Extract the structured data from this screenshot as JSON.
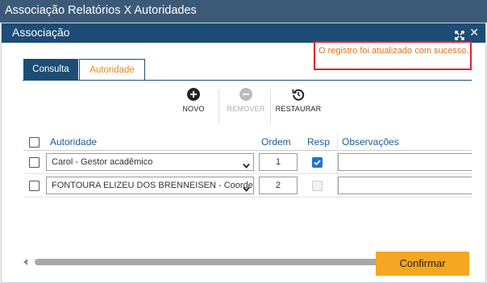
{
  "window": {
    "title": "Associação Relatórios X Autoridades"
  },
  "dialog": {
    "title": "Associação",
    "success_message": "O registro foi atualizado com sucesso."
  },
  "tabs": [
    {
      "label": "Consulta",
      "active": false
    },
    {
      "label": "Autoridade",
      "active": true
    }
  ],
  "toolbar": {
    "novo": "NOVO",
    "remover": "REMOVER",
    "restaurar": "RESTAURAR"
  },
  "grid": {
    "columns": {
      "autoridade": "Autoridade",
      "ordem": "Ordem",
      "resp": "Resp",
      "observacoes": "Observações"
    },
    "rows": [
      {
        "autoridade": "Carol - Gestor acadêmico",
        "ordem": "1",
        "resp": true,
        "observacoes": ""
      },
      {
        "autoridade": "FONTOURA ELIZEU DOS BRENNEISEN - Coordenador",
        "ordem": "2",
        "resp": false,
        "observacoes": ""
      }
    ]
  },
  "actions": {
    "confirm": "Confirmar"
  },
  "colors": {
    "header_dark": "#1d4c75",
    "accent_orange": "#f5a623",
    "error_red": "#e0232b",
    "checkbox_blue": "#1a73d9"
  }
}
